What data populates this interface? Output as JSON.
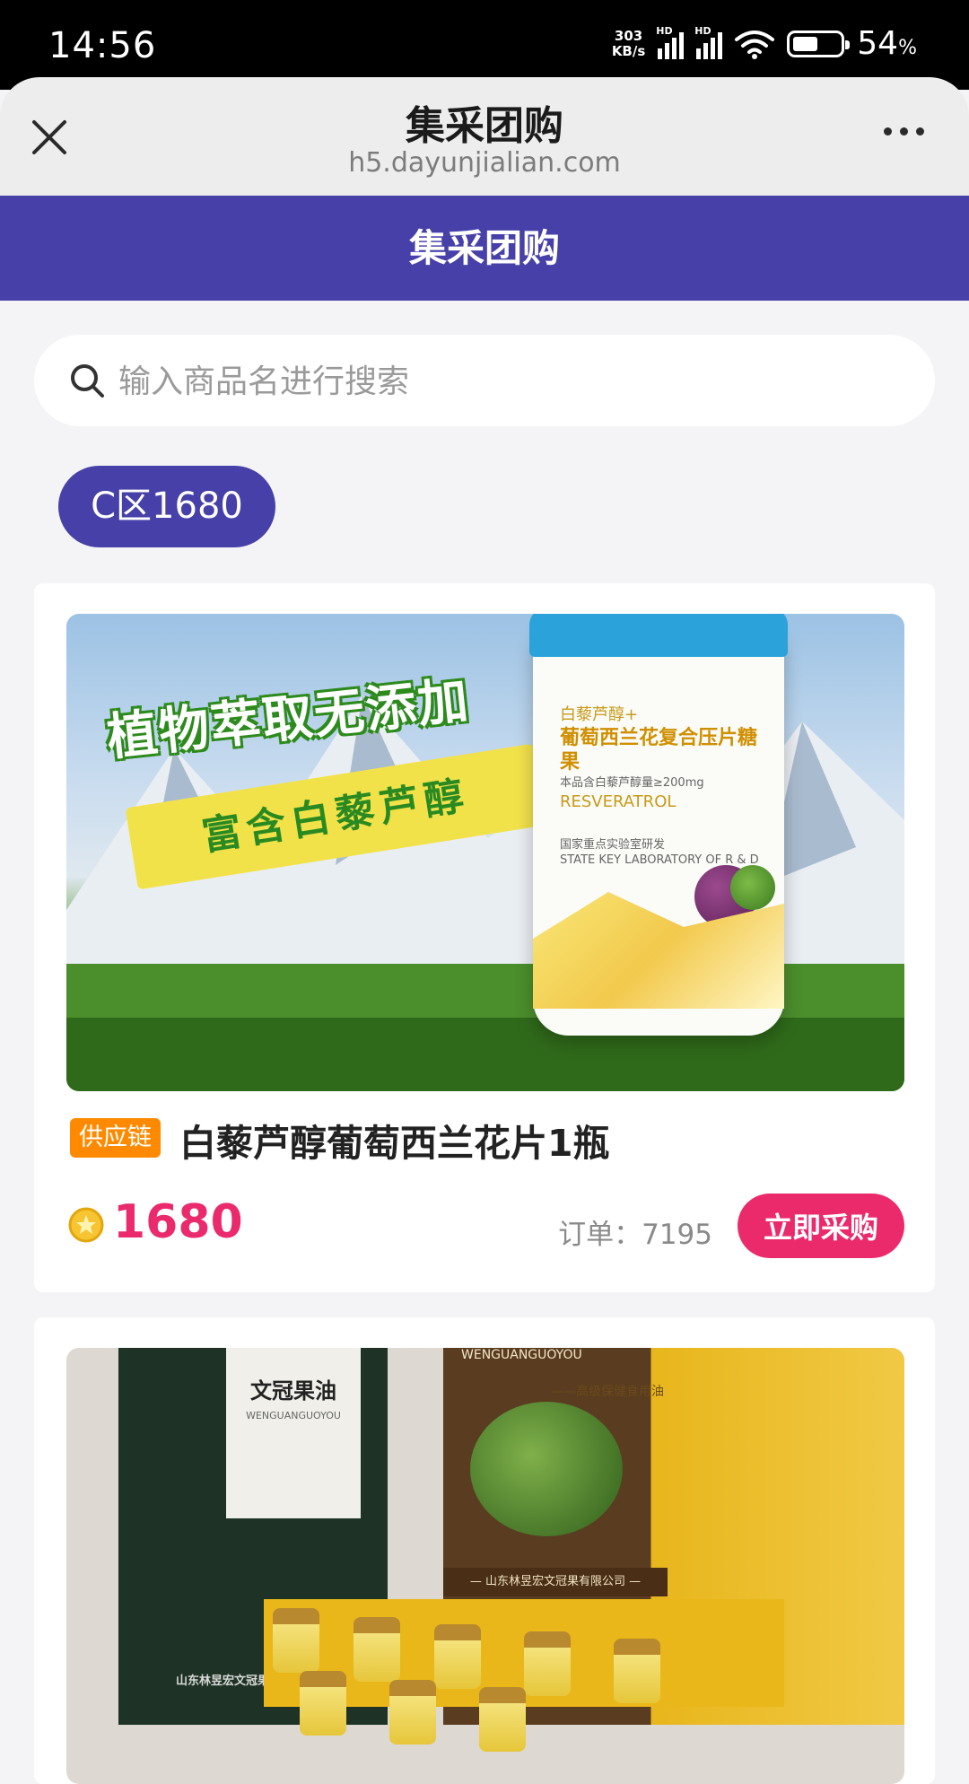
{
  "status_bar": {
    "time": "14:56",
    "net_speed_value": "303",
    "net_speed_unit": "KB/s",
    "sim1_label": "HD",
    "sim2_label": "HD",
    "battery_value": "54",
    "battery_unit": "%",
    "battery_level": 0.54
  },
  "browser": {
    "title": "集采团购",
    "url": "h5.dayunjialian.com"
  },
  "header": {
    "title": "集采团购"
  },
  "search": {
    "placeholder": "输入商品名进行搜索",
    "value": ""
  },
  "category": {
    "label": "C区1680"
  },
  "products": [
    {
      "badge": "供应链",
      "title": "白藜芦醇葡萄西兰花片1瓶",
      "price": "1680",
      "orders": "订单：7195",
      "buy_label": "立即采购",
      "image": {
        "headline": "植物萃取无添加",
        "ribbon": "富含白藜芦醇",
        "bottle_brand": "白藜芦醇+",
        "bottle_name": "葡萄西兰花复合压片糖果",
        "bottle_content": "本品含白藜芦醇量≥200mg",
        "bottle_english": "RESVERATROL",
        "bottle_lab_cn": "国家重点实验室研发",
        "bottle_lab_en": "STATE KEY LABORATORY OF R & D"
      }
    },
    {
      "image": {
        "box_title": "文冠果油",
        "box_pinyin": "WENGUANGUOYOU",
        "box_company": "山东林昱宏文冠果有限公司",
        "box_tagline": "WENGUANGUOYOU",
        "box_subtitle": "——高级保健食用油",
        "box_strip": "— 山东林昱宏文冠果有限公司 —"
      }
    }
  ],
  "colors": {
    "header_bg": "#4640a8",
    "price": "#ea2a6c",
    "buy_button": "#eb2a6c",
    "badge": "#ff8a00"
  },
  "icons": [
    "close-icon",
    "more-icon",
    "search-icon",
    "coin-icon",
    "wifi-icon",
    "battery-icon"
  ]
}
